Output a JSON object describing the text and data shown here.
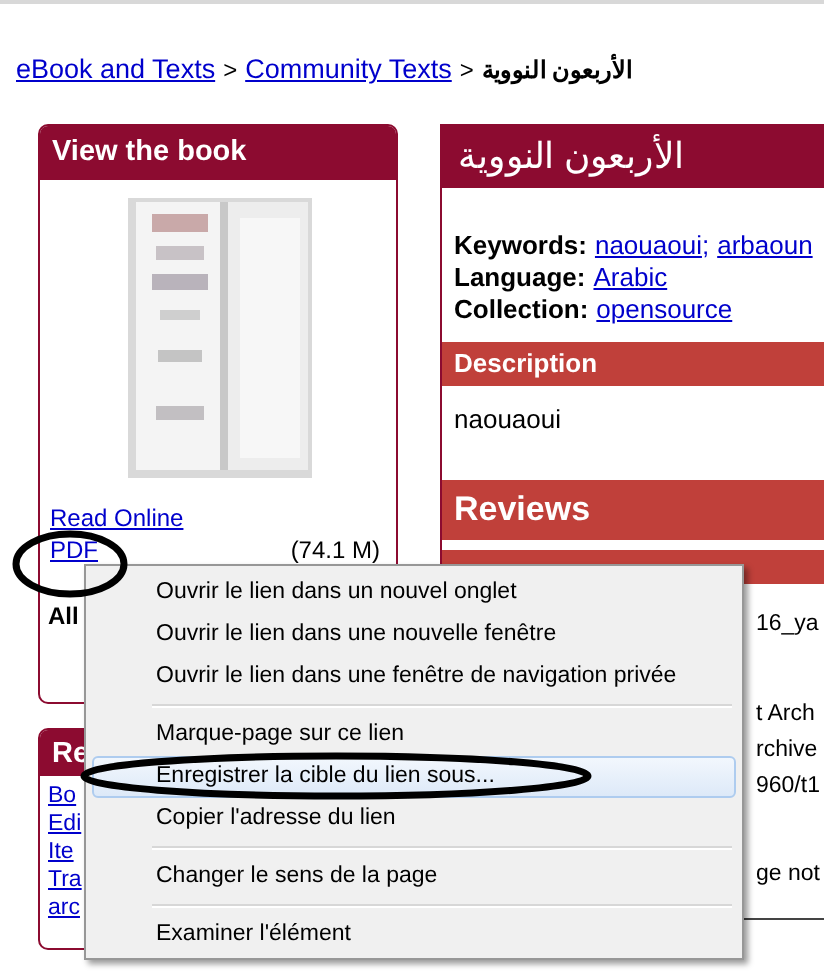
{
  "breadcrumb": [
    {
      "kind": "link",
      "label": "eBook and Texts"
    },
    {
      "kind": "separator",
      "label": ">"
    },
    {
      "kind": "link",
      "label": "Community Texts"
    },
    {
      "kind": "separator",
      "label": ">"
    },
    {
      "kind": "current",
      "label": "الأربعون النووية"
    }
  ],
  "view_panel": {
    "title": "View the book",
    "links": [
      {
        "label": "Read Online"
      },
      {
        "label": "PDF",
        "size": "(74.1 M)"
      }
    ],
    "note": "All"
  },
  "related_panel": {
    "title": "Re",
    "links": [
      "Bo",
      "Edi",
      "Ite",
      "Tra",
      "arc"
    ]
  },
  "item_panel": {
    "title": "الأربعون النووية",
    "fields": [
      {
        "label": "Keywords:",
        "separator": ";",
        "values": [
          "naouaoui",
          "arbaoun"
        ]
      },
      {
        "label": "Language:",
        "values": [
          "Arabic"
        ]
      },
      {
        "label": "Collection:",
        "values": [
          "opensource"
        ]
      }
    ],
    "description_heading": "Description",
    "description": "naouaoui",
    "reviews_heading": "Reviews",
    "text_fragments": [
      "16_ya",
      "t Arch",
      "rchive",
      "960/t1",
      "ge not"
    ]
  },
  "context_menu": [
    {
      "kind": "item",
      "label": "Ouvrir le lien dans un nouvel onglet",
      "selected": false
    },
    {
      "kind": "item",
      "label": "Ouvrir le lien dans une nouvelle fenêtre",
      "selected": false
    },
    {
      "kind": "item",
      "label": "Ouvrir le lien dans une fenêtre de navigation privée",
      "selected": false
    },
    {
      "kind": "separator"
    },
    {
      "kind": "item",
      "label": "Marque-page sur ce lien",
      "selected": false
    },
    {
      "kind": "item",
      "label": "Enregistrer la cible du lien sous...",
      "selected": true
    },
    {
      "kind": "item",
      "label": "Copier l'adresse du lien",
      "selected": false
    },
    {
      "kind": "separator"
    },
    {
      "kind": "item",
      "label": "Changer le sens de la page",
      "selected": false
    },
    {
      "kind": "separator"
    },
    {
      "kind": "item",
      "label": "Examiner l'élément",
      "selected": false
    }
  ]
}
